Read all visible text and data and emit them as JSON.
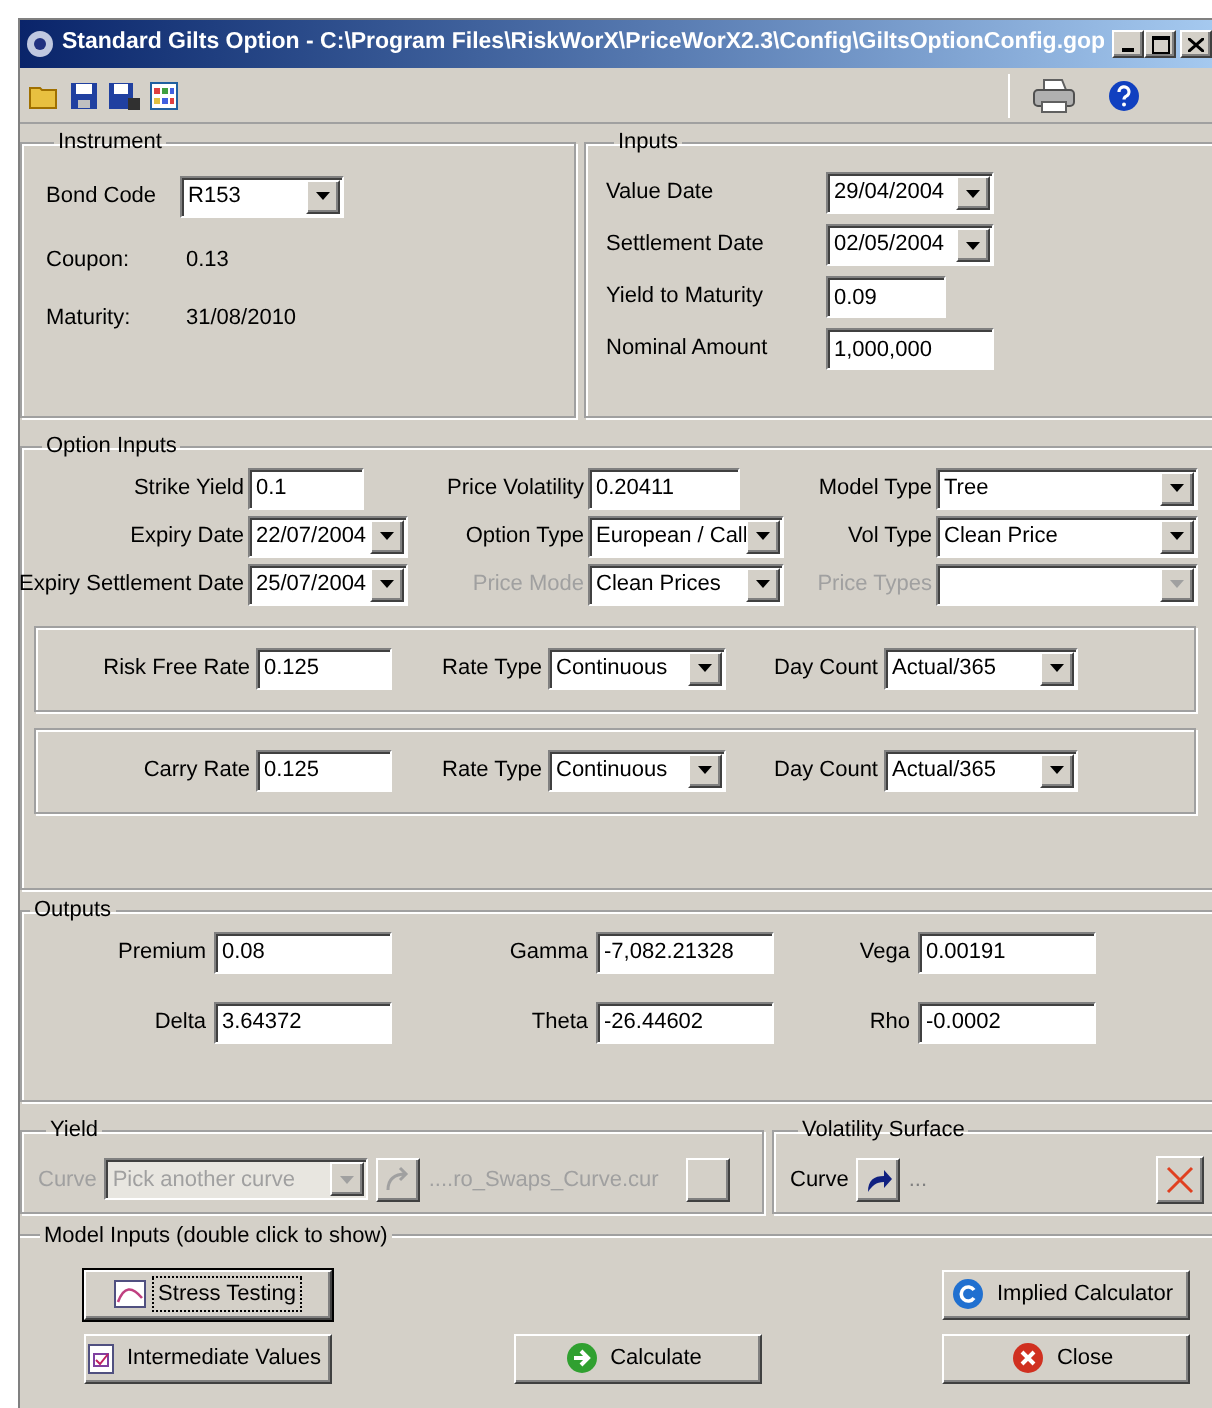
{
  "window": {
    "title": "Standard Gilts Option - C:\\Program Files\\RiskWorX\\PriceWorX2.3\\Config\\GiltsOptionConfig.gop"
  },
  "instrument": {
    "title": "Instrument",
    "bond_code": {
      "label": "Bond Code",
      "value": "R153"
    },
    "details": [
      {
        "label": "Coupon:",
        "value": "0.13"
      },
      {
        "label": "Maturity:",
        "value": "31/08/2010"
      }
    ]
  },
  "inputs": {
    "title": "Inputs",
    "fields": [
      {
        "label": "Value Date",
        "value": "29/04/2004",
        "kind": "dropdown"
      },
      {
        "label": "Settlement Date",
        "value": "02/05/2004",
        "kind": "dropdown"
      },
      {
        "label": "Yield to Maturity",
        "value": "0.09",
        "kind": "text"
      },
      {
        "label": "Nominal Amount",
        "value": "1,000,000",
        "kind": "text"
      }
    ]
  },
  "option_inputs": {
    "title": "Option Inputs",
    "fields": [
      {
        "label": "Strike Yield",
        "value": "0.1",
        "kind": "text",
        "disabled": false
      },
      {
        "label": "Price Volatility",
        "value": "0.20411",
        "kind": "text",
        "disabled": false
      },
      {
        "label": "Model Type",
        "value": "Tree",
        "kind": "dropdown",
        "disabled": false
      },
      {
        "label": "Expiry Date",
        "value": "22/07/2004",
        "kind": "dropdown",
        "disabled": false
      },
      {
        "label": "Option Type",
        "value": "European / Call",
        "kind": "dropdown",
        "disabled": false
      },
      {
        "label": "Vol Type",
        "value": "Clean Price",
        "kind": "dropdown",
        "disabled": false
      },
      {
        "label": "Expiry Settlement Date",
        "value": "25/07/2004",
        "kind": "dropdown",
        "disabled": false
      },
      {
        "label": "Price Mode",
        "value": "Clean Prices",
        "kind": "dropdown",
        "disabled": true
      },
      {
        "label": "Price Types",
        "kind": "dropdown",
        "disabled": true
      }
    ],
    "rate_panels": [
      {
        "rate": {
          "label": "Risk Free Rate",
          "value": "0.125"
        },
        "rate_type": {
          "label": "Rate Type",
          "value": "Continuous"
        },
        "day_count": {
          "label": "Day Count",
          "value": "Actual/365"
        }
      },
      {
        "rate": {
          "label": "Carry Rate",
          "value": "0.125"
        },
        "rate_type": {
          "label": "Rate Type",
          "value": "Continuous"
        },
        "day_count": {
          "label": "Day Count",
          "value": "Actual/365"
        }
      }
    ]
  },
  "outputs": {
    "title": "Outputs",
    "fields": [
      {
        "label": "Premium",
        "value": "0.08"
      },
      {
        "label": "Gamma",
        "value": "-7,082.21328"
      },
      {
        "label": "Vega",
        "value": "0.00191"
      },
      {
        "label": "Delta",
        "value": "3.64372"
      },
      {
        "label": "Theta",
        "value": "-26.44602"
      },
      {
        "label": "Rho",
        "value": "-0.0002"
      }
    ]
  },
  "yield": {
    "title": "Yield",
    "curve_label": "Curve",
    "curve_value": "Pick another curve",
    "file": "....ro_Swaps_Curve.cur",
    "disabled": true
  },
  "volatility_surface": {
    "title": "Volatility Surface",
    "curve_label": "Curve",
    "file": "..."
  },
  "model_inputs": {
    "title": "Model Inputs (double click to show)"
  },
  "button_columns": [
    [
      {
        "label": "Stress Testing",
        "kind": "stress",
        "focused": true
      },
      {
        "label": "Intermediate Values",
        "kind": "intermediate",
        "focused": false
      }
    ],
    [
      {
        "label": "Calculate",
        "kind": "calculate",
        "focused": false
      }
    ],
    [
      {
        "label": "Implied Calculator",
        "kind": "implied",
        "focused": false
      },
      {
        "label": "Close",
        "kind": "close",
        "focused": false
      }
    ]
  ]
}
